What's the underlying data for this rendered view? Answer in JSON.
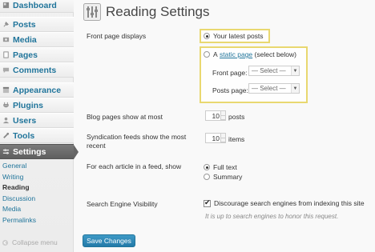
{
  "sidebar": {
    "items": [
      {
        "label": "Dashboard",
        "icon": "dashboard-icon"
      },
      {
        "label": "Posts",
        "icon": "pin-icon"
      },
      {
        "label": "Media",
        "icon": "media-icon"
      },
      {
        "label": "Pages",
        "icon": "pages-icon"
      },
      {
        "label": "Comments",
        "icon": "comment-icon"
      },
      {
        "label": "Appearance",
        "icon": "appearance-icon"
      },
      {
        "label": "Plugins",
        "icon": "plugin-icon"
      },
      {
        "label": "Users",
        "icon": "users-icon"
      },
      {
        "label": "Tools",
        "icon": "tools-icon"
      },
      {
        "label": "Settings",
        "icon": "settings-icon"
      }
    ],
    "submenu": [
      "General",
      "Writing",
      "Reading",
      "Discussion",
      "Media",
      "Permalinks"
    ],
    "current_submenu": "Reading",
    "collapse_label": "Collapse menu"
  },
  "page": {
    "title": "Reading Settings",
    "icon": "reading-settings-icon"
  },
  "front_page": {
    "label": "Front page displays",
    "option_latest": "Your latest posts",
    "option_static_prefix": "A",
    "option_static_link": "static page",
    "option_static_suffix": "(select below)",
    "selected": "latest",
    "front_page_label": "Front page:",
    "posts_page_label": "Posts page:",
    "front_page_select": "— Select —",
    "posts_page_select": "— Select —"
  },
  "blog_pages": {
    "label": "Blog pages show at most",
    "value": "10",
    "unit": "posts"
  },
  "syndication": {
    "label_line1": "Syndication feeds show the most",
    "label_line2": "recent",
    "value": "10",
    "unit": "items"
  },
  "feed_article": {
    "label": "For each article in a feed, show",
    "option_full": "Full text",
    "option_summary": "Summary",
    "selected": "full"
  },
  "search_engine": {
    "label": "Search Engine Visibility",
    "checkbox_label": "Discourage search engines from indexing this site",
    "checked": true,
    "note": "It is up to search engines to honor this request."
  },
  "save_button": "Save Changes",
  "colors": {
    "link": "#21759b",
    "highlight": "#e9d870",
    "active_menu": "#666666",
    "button": "#237aa8"
  }
}
